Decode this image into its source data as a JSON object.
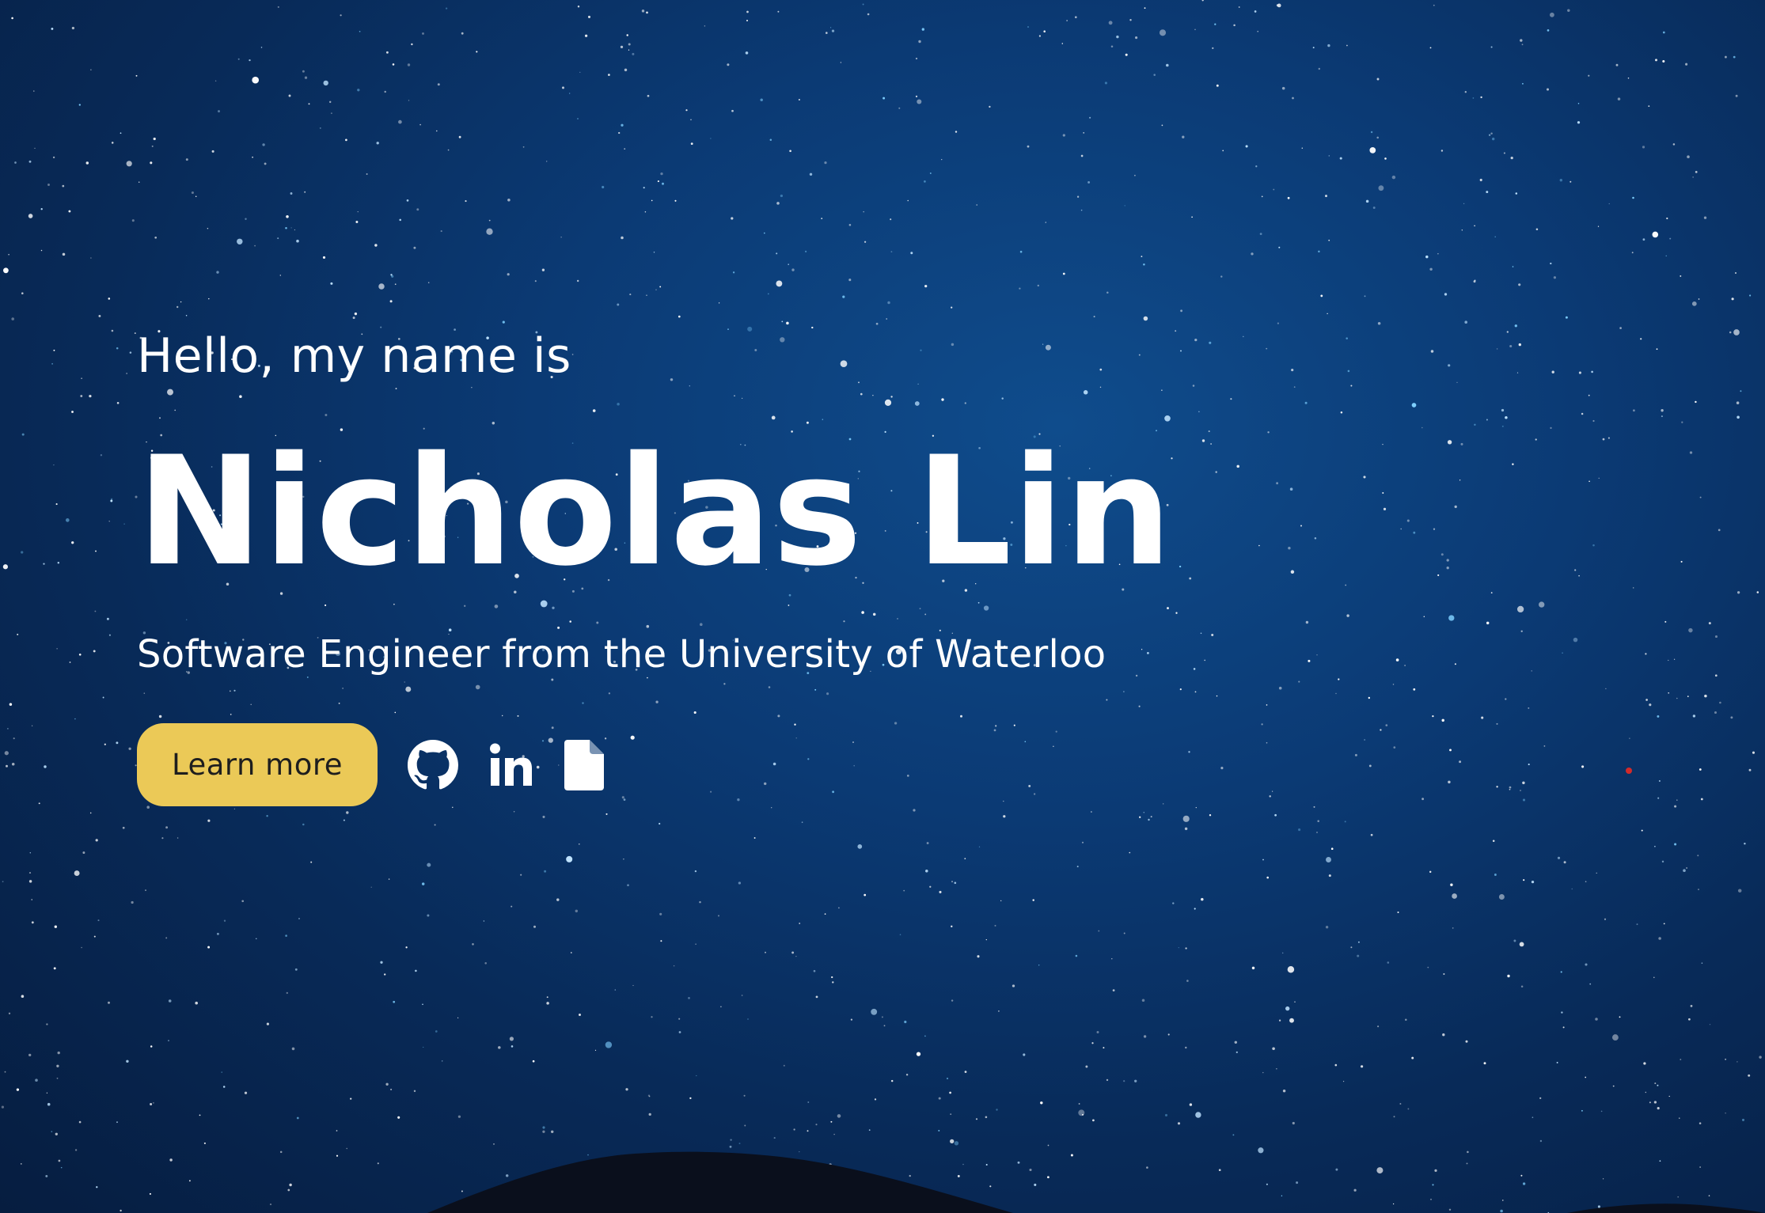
{
  "hero": {
    "greeting": "Hello, my name is",
    "name": "Nicholas Lin",
    "subtitle": "Software Engineer from the University of Waterloo",
    "learn_more_label": "Learn more"
  },
  "social_icons": [
    "github-icon",
    "linkedin-icon",
    "resume-document-icon"
  ],
  "colors": {
    "sky_top": "#0b3a74",
    "sky_bottom": "#061d40",
    "button_bg": "#ebc957",
    "text": "#ffffff",
    "mountain": "#0a0f1c"
  }
}
